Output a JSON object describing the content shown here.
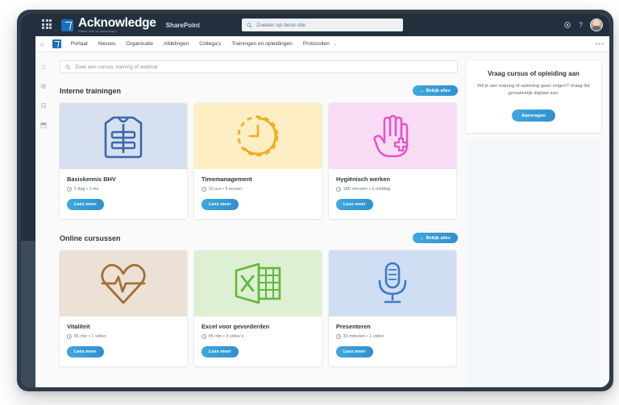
{
  "suite_bar": {
    "waffle_icon": "waffle-grid-icon",
    "brand_name": "Acknowledge",
    "brand_tagline": "Passie voor ict oplossingen",
    "product": "SharePoint",
    "search_placeholder": "Zoeken op deze site",
    "search_icon": "search-icon",
    "settings_icon": "gear-icon",
    "help_icon": "help-question-icon",
    "avatar": "user-avatar"
  },
  "nav": {
    "home_icon": "home-icon",
    "site_logo": "acknowledge-logo-icon",
    "items": [
      {
        "label": "Portaal",
        "has_chevron": false
      },
      {
        "label": "Nieuws",
        "has_chevron": false
      },
      {
        "label": "Organisatie",
        "has_chevron": false
      },
      {
        "label": "Afdelingen",
        "has_chevron": false
      },
      {
        "label": "Collega's",
        "has_chevron": false
      },
      {
        "label": "Trainingen en opleidingen",
        "has_chevron": false
      },
      {
        "label": "Protocollen",
        "has_chevron": true
      }
    ],
    "overflow": "•••",
    "chevron": "⌄"
  },
  "rail": {
    "items": [
      {
        "icon": "home-icon",
        "glyph": "⌂"
      },
      {
        "icon": "globe-icon",
        "glyph": "⊕"
      },
      {
        "icon": "briefcase-icon",
        "glyph": "⊟"
      },
      {
        "icon": "document-icon",
        "glyph": "⬒"
      }
    ]
  },
  "course_search": {
    "placeholder": "Zoek een cursus, training of webinar",
    "icon": "search-icon"
  },
  "sections": [
    {
      "title": "Interne trainingen",
      "view_all_label": "Bekijk alles",
      "cards": [
        {
          "title": "Basiskennis BHV",
          "meta": "1 dag • 1 les",
          "button": "Lees meer",
          "media_bg": "#d7e0ef",
          "media_fg": "#3b66ad",
          "icon": "safety-vest-icon"
        },
        {
          "title": "Timemanagement",
          "meta": "10 uur • 5 lessen",
          "button": "Lees meer",
          "media_bg": "#fdeec4",
          "media_fg": "#f0ad1e",
          "icon": "clock-icon"
        },
        {
          "title": "Hygiënisch werken",
          "meta": "180 minuten • 1 middag",
          "button": "Lees meer",
          "media_bg": "#f7dcf3",
          "media_fg": "#e653c9",
          "icon": "glove-hand-cross-icon"
        }
      ]
    },
    {
      "title": "Online cursussen",
      "view_all_label": "Bekijk alles",
      "cards": [
        {
          "title": "Vitaliteit",
          "meta": "45 min • 1 video",
          "button": "Lees meer",
          "media_bg": "#ece1d5",
          "media_fg": "#a3703a",
          "icon": "heart-pulse-icon"
        },
        {
          "title": "Excel voor gevorderden",
          "meta": "45 min • 3 video's",
          "button": "Lees meer",
          "media_bg": "#ddf0d4",
          "media_fg": "#64b73c",
          "icon": "excel-spreadsheet-icon"
        },
        {
          "title": "Presenteren",
          "meta": "30 minuten • 1 video",
          "button": "Lees meer",
          "media_bg": "#cfdef2",
          "media_fg": "#3c7cc4",
          "icon": "microphone-icon"
        }
      ]
    }
  ],
  "side_panel": {
    "title": "Vraag cursus of opleiding aan",
    "text": "Wil je een training of opleiding gaan volgen? Vraag die gemakkelijk digitaal aan.",
    "button": "Aanvragen"
  },
  "colors": {
    "accent": "#2f8fd0",
    "chrome_dark": "#22303e",
    "device_frame": "#2e3c4a"
  }
}
